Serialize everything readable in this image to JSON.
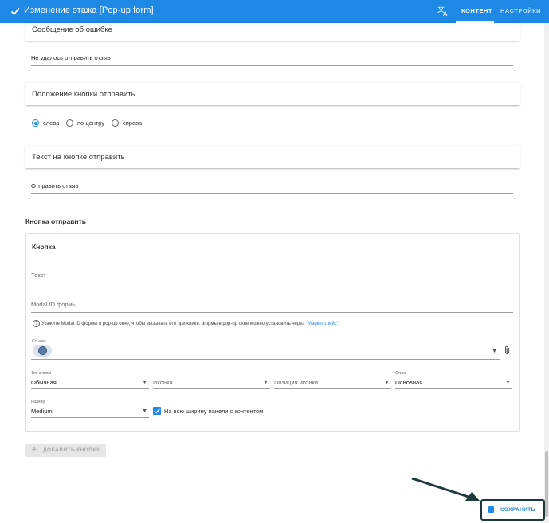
{
  "header": {
    "title": "Изменение этажа [Pop-up form]",
    "tabs": [
      {
        "label": "КОНТЕНТ",
        "active": true
      },
      {
        "label": "НАСТРОЙКИ",
        "active": false
      }
    ],
    "accent_color": "#1e88e5"
  },
  "error_message": {
    "heading": "Сообщение об ошибке",
    "value": "Не удалось отправить отзыв"
  },
  "submit_position": {
    "heading": "Положение кнопки отправить",
    "options": [
      {
        "label": "слева",
        "checked": true
      },
      {
        "label": "по центру",
        "checked": false
      },
      {
        "label": "справа",
        "checked": false
      }
    ]
  },
  "submit_text": {
    "heading": "Текст на кнопке отправить",
    "value": "Отправить отзыв"
  },
  "submit_button_section": {
    "heading": "Кнопка отправить",
    "card_title": "Кнопка",
    "text_placeholder": "Текст",
    "modal_placeholder": "Modal ID формы",
    "hint_text": "Укажите Modal ID формы в pop-up окне, чтобы вызывать его при клике. Формы в pop-up окне можно установить через ",
    "hint_link": "\"Маркетплейс\"",
    "link_label": "Ссылка",
    "button_type_label": "Тип кнопки",
    "button_type_value": "Обычная",
    "icon_placeholder": "Иконка",
    "icon_position_placeholder": "Позиция иконки",
    "style_label": "Стиль",
    "style_value": "Основная",
    "size_label": "Размер",
    "size_value": "Medium",
    "full_width_label": "На всю ширину панели с контентом",
    "full_width_checked": true
  },
  "add_button_label": "ДОБАВИТЬ КНОПКУ",
  "save_button_label": "СОХРАНИТЬ"
}
